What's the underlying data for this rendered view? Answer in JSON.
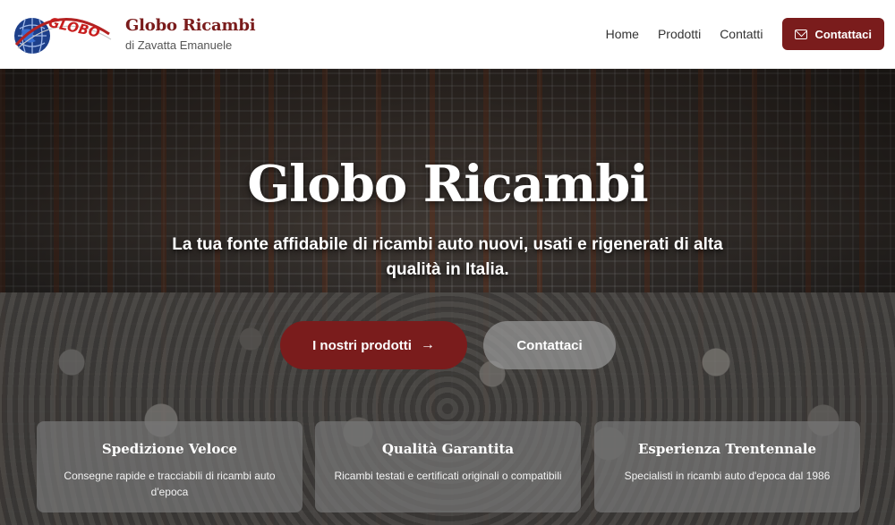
{
  "header": {
    "logo_text": "GLOBO",
    "brand_title": "Globo Ricambi",
    "brand_subtitle": "di Zavatta Emanuele",
    "nav": [
      {
        "label": "Home"
      },
      {
        "label": "Prodotti"
      },
      {
        "label": "Contatti"
      }
    ],
    "contact_button": "Contattaci"
  },
  "hero": {
    "title": "Globo Ricambi",
    "subtitle": "La tua fonte affidabile di ricambi auto nuovi, usati e rigenerati di alta qualità in Italia.",
    "primary_button": "I nostri prodotti",
    "secondary_button": "Contattaci"
  },
  "features": [
    {
      "title": "Spedizione Veloce",
      "text": "Consegne rapide e tracciabili di ricambi auto d'epoca"
    },
    {
      "title": "Qualità Garantita",
      "text": "Ricambi testati e certificati originali o compatibili"
    },
    {
      "title": "Esperienza Trentennale",
      "text": "Specialisti in ricambi auto d'epoca dal 1986"
    }
  ],
  "colors": {
    "accent": "#7a1c1c"
  }
}
